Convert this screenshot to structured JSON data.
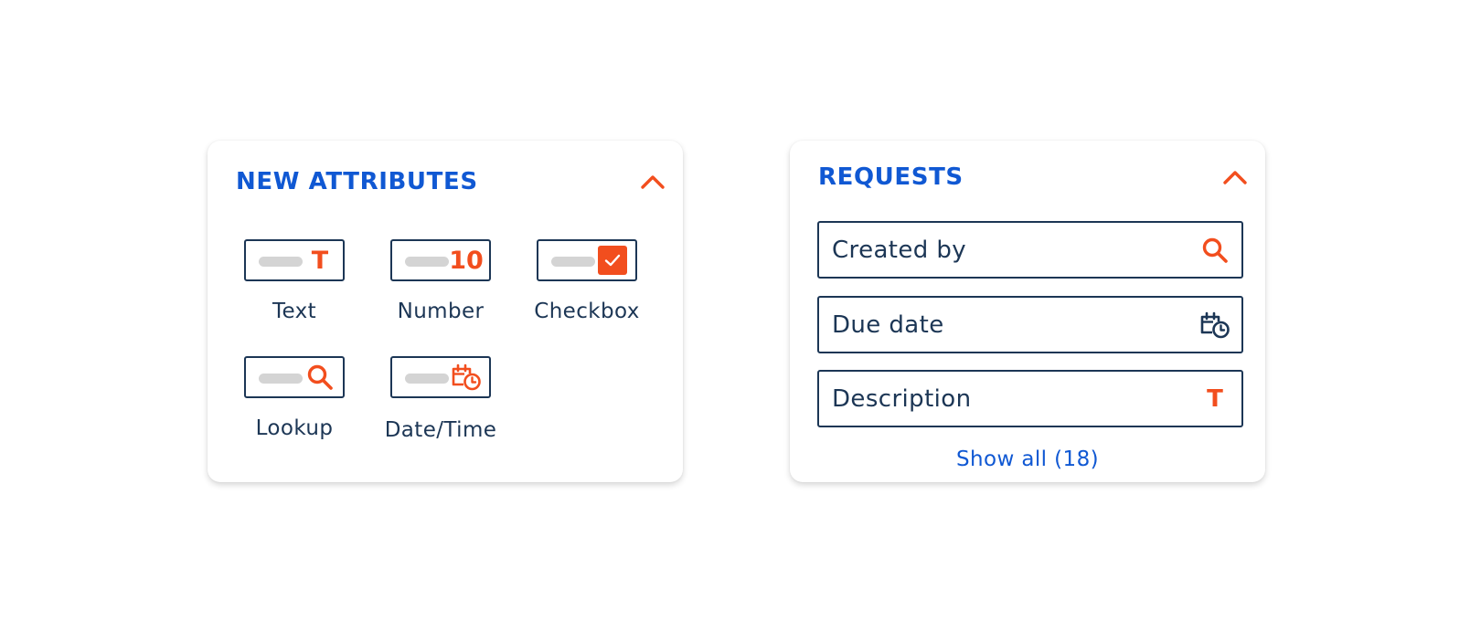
{
  "colors": {
    "accent_blue": "#1058d3",
    "accent_orange": "#f24e1e",
    "navy": "#1c3655",
    "placeholder_gray": "#d4d4d4"
  },
  "new_attributes": {
    "title": "NEW ATTRIBUTES",
    "collapse_icon": "chevron-up-icon",
    "items": [
      {
        "label": "Text",
        "icon": "text-t-icon",
        "glyph": "T"
      },
      {
        "label": "Number",
        "icon": "number-icon",
        "glyph": "10"
      },
      {
        "label": "Checkbox",
        "icon": "checkbox-checked-icon"
      },
      {
        "label": "Lookup",
        "icon": "search-icon"
      },
      {
        "label": "Date/Time",
        "icon": "calendar-clock-icon"
      }
    ]
  },
  "requests": {
    "title": "REQUESTS",
    "collapse_icon": "chevron-up-icon",
    "fields": [
      {
        "label": "Created by",
        "icon": "search-icon"
      },
      {
        "label": "Due date",
        "icon": "calendar-clock-icon"
      },
      {
        "label": "Description",
        "icon": "text-t-icon",
        "glyph": "T"
      }
    ],
    "show_all": "Show all (18)"
  }
}
